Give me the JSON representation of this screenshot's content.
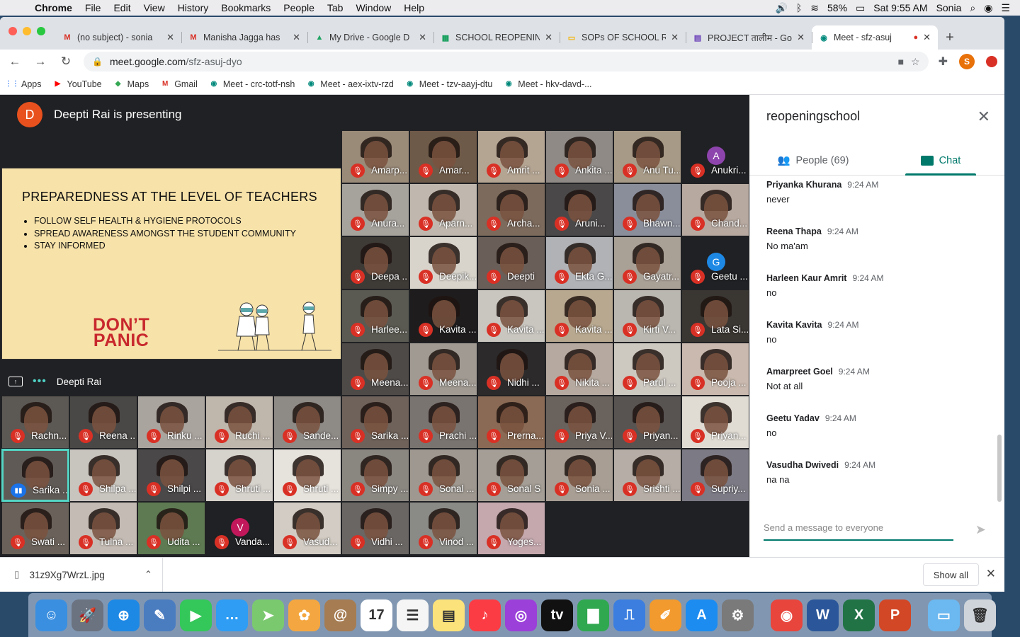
{
  "menubar": {
    "app": "Chrome",
    "items": [
      "File",
      "Edit",
      "View",
      "History",
      "Bookmarks",
      "People",
      "Tab",
      "Window",
      "Help"
    ],
    "battery": "58%",
    "clock": "Sat 9:55 AM",
    "user": "Sonia"
  },
  "tabs": [
    {
      "title": "(no subject) - sonia",
      "icon": "gmail-icon",
      "color": "#d93025",
      "glyph": "M"
    },
    {
      "title": "Manisha Jagga has",
      "icon": "gmail-icon",
      "color": "#d93025",
      "glyph": "M"
    },
    {
      "title": "My Drive - Google D",
      "icon": "drive-icon",
      "color": "#1fa463",
      "glyph": "▲"
    },
    {
      "title": "SCHOOL REOPENIN",
      "icon": "sheets-icon",
      "color": "#0f9d58",
      "glyph": "▦"
    },
    {
      "title": "SOPs OF SCHOOL R",
      "icon": "slides-icon",
      "color": "#f4b400",
      "glyph": "▭"
    },
    {
      "title": "PROJECT तालीम - Go",
      "icon": "forms-icon",
      "color": "#673ab7",
      "glyph": "▤"
    },
    {
      "title": "Meet - sfz-asuj",
      "icon": "meet-icon",
      "color": "#00897b",
      "glyph": "◉"
    }
  ],
  "url": {
    "host": "meet.google.com",
    "path": "/sfz-asuj-dyo"
  },
  "profile_initial": "S",
  "bookmarks": [
    {
      "label": "Apps",
      "icon": "apps-icon"
    },
    {
      "label": "YouTube",
      "icon": "youtube-icon"
    },
    {
      "label": "Maps",
      "icon": "maps-icon"
    },
    {
      "label": "Gmail",
      "icon": "gmail-icon"
    },
    {
      "label": "Meet - crc-totf-nsh",
      "icon": "meet-icon"
    },
    {
      "label": "Meet - aex-ixtv-rzd",
      "icon": "meet-icon"
    },
    {
      "label": "Meet - tzv-aayj-dtu",
      "icon": "meet-icon"
    },
    {
      "label": "Meet - hkv-davd-...",
      "icon": "meet-icon"
    }
  ],
  "presenter": {
    "initial": "D",
    "banner": "Deepti Rai is presenting",
    "name": "Deepti Rai"
  },
  "slide": {
    "title": "PREPAREDNESS AT THE LEVEL OF TEACHERS",
    "bullets": [
      "FOLLOW SELF HEALTH & HYGIENE PROTOCOLS",
      "SPREAD AWARENESS AMONGST THE STUDENT COMMUNITY",
      "STAY INFORMED"
    ],
    "panic_line1": "DON’T",
    "panic_line2": "PANIC"
  },
  "participants": [
    {
      "name": "Amarp...",
      "bg": "#9a8a78"
    },
    {
      "name": "Amar...",
      "bg": "#6e5a48"
    },
    {
      "name": "Amrit ...",
      "bg": "#b4a492"
    },
    {
      "name": "Ankita ...",
      "bg": "#8f8a86"
    },
    {
      "name": "Anu Tu...",
      "bg": "#a79a86"
    },
    {
      "name": "Anukri...",
      "bg": "",
      "letter": "A",
      "lcolor": "#8e44ad"
    },
    {
      "name": "Anura...",
      "bg": "#a6a29c"
    },
    {
      "name": "Aparn...",
      "bg": "#c0b8ae"
    },
    {
      "name": "Archa...",
      "bg": "#7c6a5c"
    },
    {
      "name": "Aruni...",
      "bg": "#4a4848"
    },
    {
      "name": "Bhawn...",
      "bg": "#8a8e9a"
    },
    {
      "name": "Chand...",
      "bg": "#b7a9a0"
    },
    {
      "name": "Deepa ...",
      "bg": "#3e3a36"
    },
    {
      "name": "Deepik...",
      "bg": "#d8d4cc"
    },
    {
      "name": "Deepti",
      "bg": "#6a5e58"
    },
    {
      "name": "Ekta G...",
      "bg": "#b0b2b6"
    },
    {
      "name": "Gayatr...",
      "bg": "#a9a096"
    },
    {
      "name": "Geetu ...",
      "bg": "",
      "letter": "G",
      "lcolor": "#1e88e5"
    },
    {
      "name": "Harlee...",
      "bg": "#5a5a52"
    },
    {
      "name": "Kavita ...",
      "bg": "#1e1c1c"
    },
    {
      "name": "Kavita ...",
      "bg": "#c9c6c0"
    },
    {
      "name": "Kavita ...",
      "bg": "#b8a890"
    },
    {
      "name": "Kirti V...",
      "bg": "#bab7b0"
    },
    {
      "name": "Lata Si...",
      "bg": "#3a3632"
    },
    {
      "name": "Meena...",
      "bg": "#4e4a48"
    },
    {
      "name": "Meena...",
      "bg": "#a09a92"
    },
    {
      "name": "Nidhi ...",
      "bg": "#2c2a2a"
    },
    {
      "name": "Nikita ...",
      "bg": "#b6aaa0"
    },
    {
      "name": "Parul ...",
      "bg": "#cdc8c0"
    },
    {
      "name": "Pooja ...",
      "bg": "#c9b9ae"
    },
    {
      "name": "Rachn...",
      "bg": "#5c5854"
    },
    {
      "name": "Reena ...",
      "bg": "#4a4846"
    },
    {
      "name": "Rinku ...",
      "bg": "#aaa49e"
    },
    {
      "name": "Ruchi ...",
      "bg": "#bfb6ac"
    },
    {
      "name": "Sande...",
      "bg": "#8e8a86"
    },
    {
      "name": "Sarika ...",
      "bg": "#6e625a"
    },
    {
      "name": "Prachi ...",
      "bg": "#7a7470"
    },
    {
      "name": "Prerna...",
      "bg": "#8a6a54"
    },
    {
      "name": "Priya V...",
      "bg": "#6a625c"
    },
    {
      "name": "Priyan...",
      "bg": "#585452"
    },
    {
      "name": "Priyan...",
      "bg": "#e0dcd4"
    },
    {
      "name": "Sarika ...",
      "bg": "#605a56",
      "active": true
    },
    {
      "name": "Shilpa ...",
      "bg": "#c8c4be"
    },
    {
      "name": "Shilpi ...",
      "bg": "#4a4848"
    },
    {
      "name": "Shruti ...",
      "bg": "#d6d2cc"
    },
    {
      "name": "Shruti ...",
      "bg": "#e6e2dc"
    },
    {
      "name": "Simpy ...",
      "bg": "#8a8680"
    },
    {
      "name": "Sonal ...",
      "bg": "#9e9890"
    },
    {
      "name": "Sonal S",
      "bg": "#a49e96"
    },
    {
      "name": "Sonia ...",
      "bg": "#a89e94"
    },
    {
      "name": "Srishti ...",
      "bg": "#b6aea6"
    },
    {
      "name": "Supriy...",
      "bg": "#7c7a84"
    },
    {
      "name": "Swati ...",
      "bg": "#6a625a"
    },
    {
      "name": "Tulna ...",
      "bg": "#c4bcb4"
    },
    {
      "name": "Udita ...",
      "bg": "#5e7a52"
    },
    {
      "name": "Vanda...",
      "bg": "",
      "letter": "V",
      "lcolor": "#c2185b"
    },
    {
      "name": "Vasud...",
      "bg": "#d2ccc4"
    },
    {
      "name": "Vidhi ...",
      "bg": "#6a6664"
    },
    {
      "name": "Vinod ...",
      "bg": "#8a8a86"
    },
    {
      "name": "Yoges...",
      "bg": "#c4a8ae"
    }
  ],
  "chat": {
    "room": "reopeningschool",
    "people_tab": "People (69)",
    "chat_tab": "Chat",
    "messages": [
      {
        "sender": "Priyanka Khurana",
        "time": "9:24 AM",
        "text": "never"
      },
      {
        "sender": "Reena Thapa",
        "time": "9:24 AM",
        "text": "No ma'am"
      },
      {
        "sender": "Harleen Kaur Amrit",
        "time": "9:24 AM",
        "text": "no"
      },
      {
        "sender": "Kavita Kavita",
        "time": "9:24 AM",
        "text": "no"
      },
      {
        "sender": "Amarpreet Goel",
        "time": "9:24 AM",
        "text": "Not at all"
      },
      {
        "sender": "Geetu Yadav",
        "time": "9:24 AM",
        "text": "no"
      },
      {
        "sender": "Vasudha Dwivedi",
        "time": "9:24 AM",
        "text": "na na"
      }
    ],
    "compose_placeholder": "Send a message to everyone"
  },
  "download": {
    "file": "31z9Xg7WrzL.jpg",
    "show_all": "Show all"
  },
  "dock": [
    {
      "icon": "finder-icon",
      "color": "#3b8fe0",
      "glyph": "☺"
    },
    {
      "icon": "launchpad-icon",
      "color": "#6b7280",
      "glyph": "🚀"
    },
    {
      "icon": "safari-icon",
      "color": "#1e88e5",
      "glyph": "⊕"
    },
    {
      "icon": "preview-icon",
      "color": "#4a7cc0",
      "glyph": "✎"
    },
    {
      "icon": "facetime-icon",
      "color": "#34c759",
      "glyph": "▶"
    },
    {
      "icon": "messages-icon",
      "color": "#2f9df4",
      "glyph": "…"
    },
    {
      "icon": "maps-app-icon",
      "color": "#7bc96f",
      "glyph": "➤"
    },
    {
      "icon": "photos-icon",
      "color": "#f4a740",
      "glyph": "✿"
    },
    {
      "icon": "contacts-icon",
      "color": "#a67c52",
      "glyph": "@"
    },
    {
      "icon": "calendar-icon",
      "color": "#ffffff",
      "glyph": "17"
    },
    {
      "icon": "reminders-icon",
      "color": "#f5f5f5",
      "glyph": "☰"
    },
    {
      "icon": "notes-icon",
      "color": "#fbe27a",
      "glyph": "▤"
    },
    {
      "icon": "music-icon",
      "color": "#fc3c44",
      "glyph": "♪"
    },
    {
      "icon": "podcasts-icon",
      "color": "#9b40d9",
      "glyph": "◎"
    },
    {
      "icon": "tv-icon",
      "color": "#111111",
      "glyph": "tv"
    },
    {
      "icon": "numbers-icon",
      "color": "#2fa84f",
      "glyph": "▇"
    },
    {
      "icon": "keynote-icon",
      "color": "#3b7ee0",
      "glyph": "⎍"
    },
    {
      "icon": "pages-icon",
      "color": "#f29a2e",
      "glyph": "✐"
    },
    {
      "icon": "app-store-icon",
      "color": "#1c8cf0",
      "glyph": "A"
    },
    {
      "icon": "system-preferences-icon",
      "color": "#7a7a7a",
      "glyph": "⚙"
    },
    {
      "icon": "chrome-icon",
      "color": "#e8453c",
      "glyph": "◉"
    },
    {
      "icon": "word-icon",
      "color": "#2b579a",
      "glyph": "W"
    },
    {
      "icon": "excel-icon",
      "color": "#217346",
      "glyph": "X"
    },
    {
      "icon": "powerpoint-icon",
      "color": "#d24726",
      "glyph": "P"
    },
    {
      "icon": "downloads-folder-icon",
      "color": "#6cb8f0",
      "glyph": "▭"
    },
    {
      "icon": "trash-icon",
      "color": "#cfd4da",
      "glyph": "🗑"
    }
  ]
}
